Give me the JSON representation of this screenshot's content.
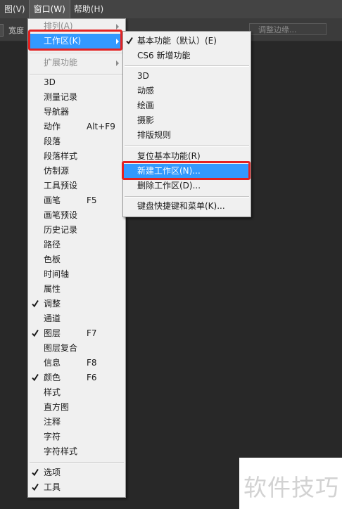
{
  "menubar": {
    "items": [
      {
        "label": "图(V)"
      },
      {
        "label": "窗口(W)"
      },
      {
        "label": "帮助(H)"
      }
    ]
  },
  "options_bar": {
    "width_label": "宽度",
    "right_button": "调整边缘..."
  },
  "window_menu": {
    "items": [
      {
        "label": "排列(A)"
      },
      {
        "label": "工作区(K)"
      },
      {
        "label": "扩展功能"
      },
      {
        "label": "3D"
      },
      {
        "label": "测量记录"
      },
      {
        "label": "导航器"
      },
      {
        "label": "动作",
        "shortcut": "Alt+F9"
      },
      {
        "label": "段落"
      },
      {
        "label": "段落样式"
      },
      {
        "label": "仿制源"
      },
      {
        "label": "工具预设"
      },
      {
        "label": "画笔",
        "shortcut": "F5"
      },
      {
        "label": "画笔预设"
      },
      {
        "label": "历史记录"
      },
      {
        "label": "路径"
      },
      {
        "label": "色板"
      },
      {
        "label": "时间轴"
      },
      {
        "label": "属性"
      },
      {
        "label": "调整"
      },
      {
        "label": "通道"
      },
      {
        "label": "图层",
        "shortcut": "F7"
      },
      {
        "label": "图层复合"
      },
      {
        "label": "信息",
        "shortcut": "F8"
      },
      {
        "label": "颜色",
        "shortcut": "F6"
      },
      {
        "label": "样式"
      },
      {
        "label": "直方图"
      },
      {
        "label": "注释"
      },
      {
        "label": "字符"
      },
      {
        "label": "字符样式"
      },
      {
        "label": "选项"
      },
      {
        "label": "工具"
      }
    ]
  },
  "workspace_menu": {
    "items": [
      {
        "label": "基本功能（默认）(E)"
      },
      {
        "label": "CS6 新增功能"
      },
      {
        "label": "3D"
      },
      {
        "label": "动感"
      },
      {
        "label": "绘画"
      },
      {
        "label": "摄影"
      },
      {
        "label": "排版规则"
      },
      {
        "label": "复位基本功能(R)"
      },
      {
        "label": "新建工作区(N)..."
      },
      {
        "label": "删除工作区(D)..."
      },
      {
        "label": "键盘快捷键和菜单(K)..."
      }
    ]
  },
  "watermark": {
    "text": "软件技巧"
  },
  "colors": {
    "highlight": "#3399ff",
    "annotation_red": "#e32222",
    "menu_bg": "#f0f0f0",
    "canvas_bg": "#282828"
  }
}
